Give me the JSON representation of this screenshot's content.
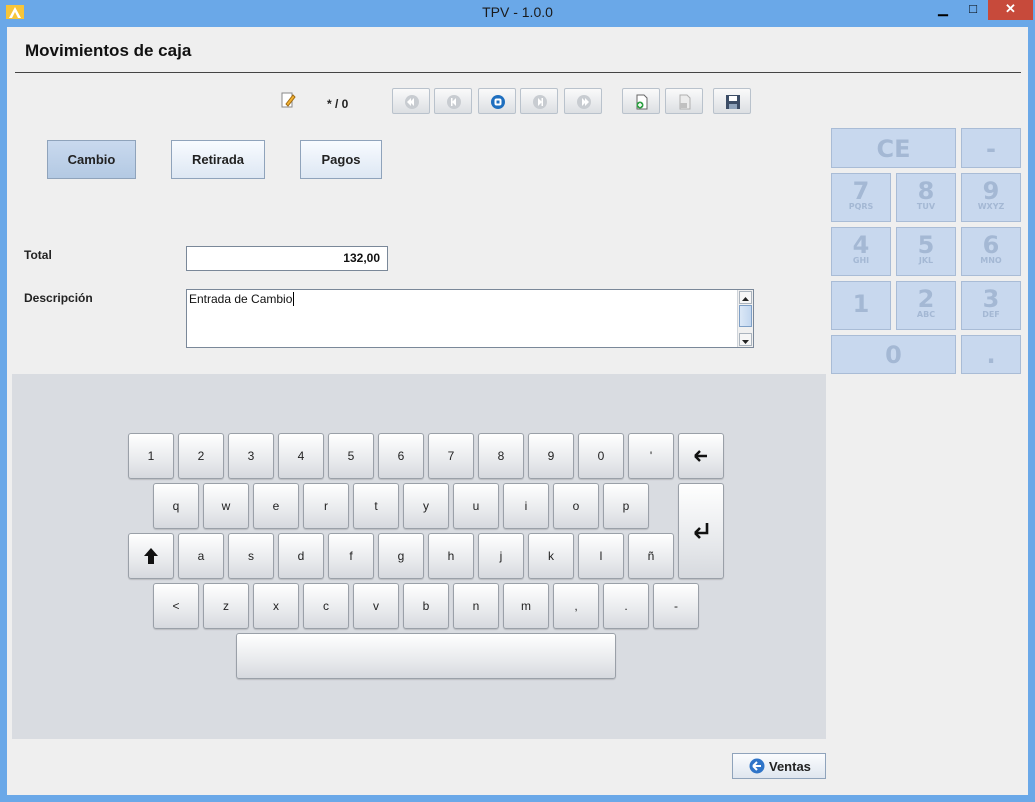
{
  "window": {
    "title": "TPV - 1.0.0",
    "minimize": "▁",
    "maximize": "□",
    "close": "✕"
  },
  "page": {
    "title": "Movimientos de caja"
  },
  "toolbar": {
    "counter": "* / 0",
    "icons": [
      "edit-icon",
      "first-record-icon",
      "previous-record-icon",
      "refresh-icon",
      "next-record-icon",
      "last-record-icon",
      "new-record-icon",
      "delete-record-icon",
      "save-icon"
    ]
  },
  "tabs": {
    "cambio": "Cambio",
    "retirada": "Retirada",
    "pagos": "Pagos"
  },
  "form": {
    "total_label": "Total",
    "total_value": "132,00",
    "descripcion_label": "Descripción",
    "descripcion_value": "Entrada de Cambio"
  },
  "numpad": {
    "ce": "CE",
    "minus": "-",
    "k7": "7",
    "k7_sub": "PQRS",
    "k8": "8",
    "k8_sub": "TUV",
    "k9": "9",
    "k9_sub": "WXYZ",
    "k4": "4",
    "k4_sub": "GHI",
    "k5": "5",
    "k5_sub": "JKL",
    "k6": "6",
    "k6_sub": "MNO",
    "k1": "1",
    "k2": "2",
    "k2_sub": "ABC",
    "k3": "3",
    "k3_sub": "DEF",
    "k0": "0",
    "dot": "."
  },
  "keyboard": {
    "row1": [
      "1",
      "2",
      "3",
      "4",
      "5",
      "6",
      "7",
      "8",
      "9",
      "0",
      "'"
    ],
    "row2": [
      "q",
      "w",
      "e",
      "r",
      "t",
      "y",
      "u",
      "i",
      "o",
      "p"
    ],
    "row3": [
      "a",
      "s",
      "d",
      "f",
      "g",
      "h",
      "j",
      "k",
      "l",
      "ñ"
    ],
    "row4": [
      "<",
      "z",
      "x",
      "c",
      "v",
      "b",
      "n",
      "m",
      ",",
      ".",
      "-"
    ],
    "backspace": "🡐",
    "enter": "↵",
    "shift": "⬆"
  },
  "footer": {
    "ventas": "Ventas"
  },
  "colors": {
    "titlebar": "#6aa8e8",
    "close": "#c74a3b",
    "active_tab": "#b3c9e3",
    "numpad": "#c8d8ee",
    "keyboard_bg": "#d9dce1"
  }
}
